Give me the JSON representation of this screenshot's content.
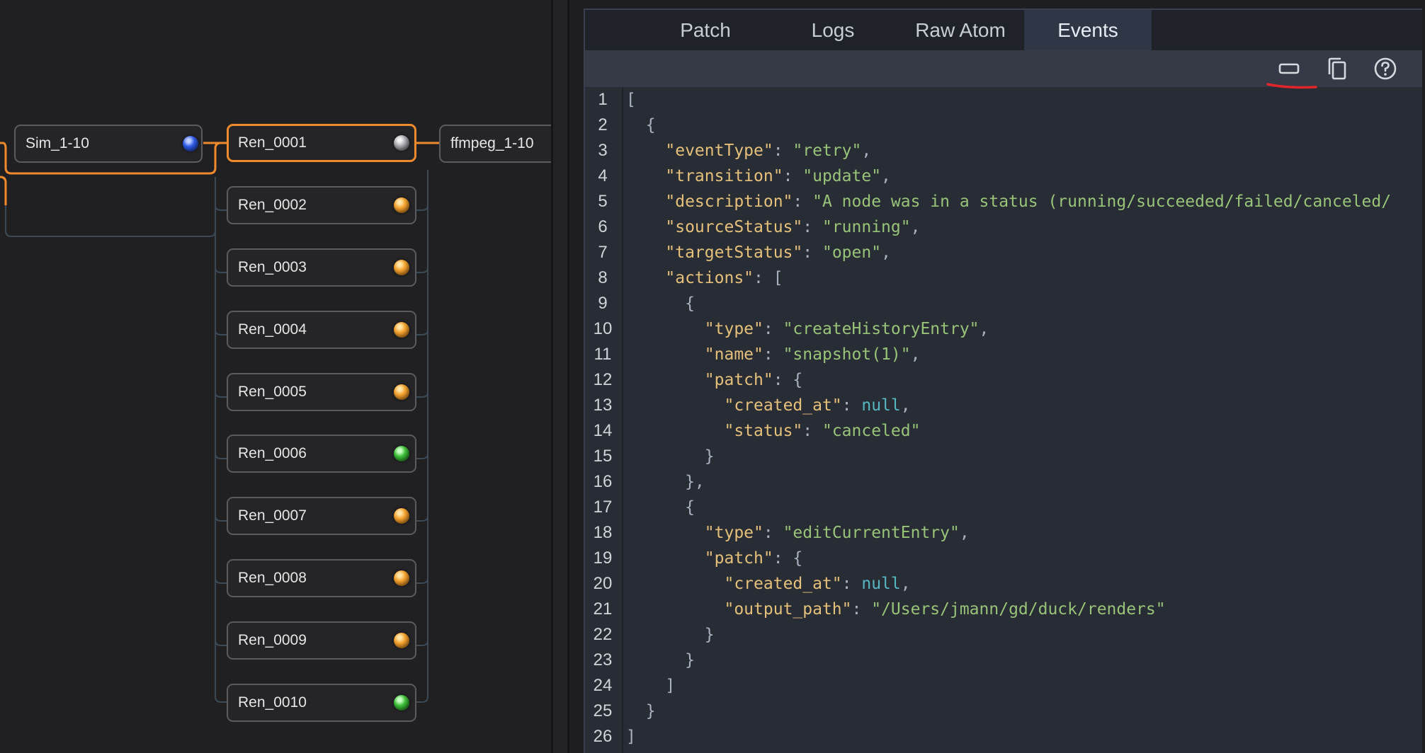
{
  "graph": {
    "nodes": [
      {
        "label": "Sim_1-10",
        "status": "blue"
      },
      {
        "label": "Ren_0001",
        "status": "grey",
        "selected": true
      },
      {
        "label": "ffmpeg_1-10"
      },
      {
        "label": "Ren_0002",
        "status": "orange"
      },
      {
        "label": "Ren_0003",
        "status": "orange"
      },
      {
        "label": "Ren_0004",
        "status": "orange"
      },
      {
        "label": "Ren_0005",
        "status": "orange"
      },
      {
        "label": "Ren_0006",
        "status": "green"
      },
      {
        "label": "Ren_0007",
        "status": "orange"
      },
      {
        "label": "Ren_0008",
        "status": "orange"
      },
      {
        "label": "Ren_0009",
        "status": "orange"
      },
      {
        "label": "Ren_0010",
        "status": "green"
      }
    ]
  },
  "inspector": {
    "tabs": [
      {
        "label": "Patch"
      },
      {
        "label": "Logs"
      },
      {
        "label": "Raw Atom"
      },
      {
        "label": "Events",
        "active": true
      }
    ],
    "toolbar": {
      "icons": [
        "collapse-icon",
        "copy-icon",
        "help-icon"
      ]
    },
    "line_numbers": [
      "1",
      "2",
      "3",
      "4",
      "5",
      "6",
      "7",
      "8",
      "9",
      "10",
      "11",
      "12",
      "13",
      "14",
      "15",
      "16",
      "17",
      "18",
      "19",
      "20",
      "21",
      "22",
      "23",
      "24",
      "25",
      "26"
    ],
    "json_lines": [
      [
        [
          "p",
          "["
        ]
      ],
      [
        [
          "p",
          "  {"
        ]
      ],
      [
        [
          "p",
          "    "
        ],
        [
          "k",
          "\"eventType\""
        ],
        [
          "p",
          ": "
        ],
        [
          "s",
          "\"retry\""
        ],
        [
          "p",
          ","
        ]
      ],
      [
        [
          "p",
          "    "
        ],
        [
          "k",
          "\"transition\""
        ],
        [
          "p",
          ": "
        ],
        [
          "s",
          "\"update\""
        ],
        [
          "p",
          ","
        ]
      ],
      [
        [
          "p",
          "    "
        ],
        [
          "k",
          "\"description\""
        ],
        [
          "p",
          ": "
        ],
        [
          "s",
          "\"A node was in a status (running/succeeded/failed/canceled/"
        ]
      ],
      [
        [
          "p",
          "    "
        ],
        [
          "k",
          "\"sourceStatus\""
        ],
        [
          "p",
          ": "
        ],
        [
          "s",
          "\"running\""
        ],
        [
          "p",
          ","
        ]
      ],
      [
        [
          "p",
          "    "
        ],
        [
          "k",
          "\"targetStatus\""
        ],
        [
          "p",
          ": "
        ],
        [
          "s",
          "\"open\""
        ],
        [
          "p",
          ","
        ]
      ],
      [
        [
          "p",
          "    "
        ],
        [
          "k",
          "\"actions\""
        ],
        [
          "p",
          ": ["
        ]
      ],
      [
        [
          "p",
          "      {"
        ]
      ],
      [
        [
          "p",
          "        "
        ],
        [
          "k",
          "\"type\""
        ],
        [
          "p",
          ": "
        ],
        [
          "s",
          "\"createHistoryEntry\""
        ],
        [
          "p",
          ","
        ]
      ],
      [
        [
          "p",
          "        "
        ],
        [
          "k",
          "\"name\""
        ],
        [
          "p",
          ": "
        ],
        [
          "s",
          "\"snapshot(1)\""
        ],
        [
          "p",
          ","
        ]
      ],
      [
        [
          "p",
          "        "
        ],
        [
          "k",
          "\"patch\""
        ],
        [
          "p",
          ": {"
        ]
      ],
      [
        [
          "p",
          "          "
        ],
        [
          "k",
          "\"created_at\""
        ],
        [
          "p",
          ": "
        ],
        [
          "n",
          "null"
        ],
        [
          "p",
          ","
        ]
      ],
      [
        [
          "p",
          "          "
        ],
        [
          "k",
          "\"status\""
        ],
        [
          "p",
          ": "
        ],
        [
          "s",
          "\"canceled\""
        ]
      ],
      [
        [
          "p",
          "        }"
        ]
      ],
      [
        [
          "p",
          "      },"
        ]
      ],
      [
        [
          "p",
          "      {"
        ]
      ],
      [
        [
          "p",
          "        "
        ],
        [
          "k",
          "\"type\""
        ],
        [
          "p",
          ": "
        ],
        [
          "s",
          "\"editCurrentEntry\""
        ],
        [
          "p",
          ","
        ]
      ],
      [
        [
          "p",
          "        "
        ],
        [
          "k",
          "\"patch\""
        ],
        [
          "p",
          ": {"
        ]
      ],
      [
        [
          "p",
          "          "
        ],
        [
          "k",
          "\"created_at\""
        ],
        [
          "p",
          ": "
        ],
        [
          "n",
          "null"
        ],
        [
          "p",
          ","
        ]
      ],
      [
        [
          "p",
          "          "
        ],
        [
          "k",
          "\"output_path\""
        ],
        [
          "p",
          ": "
        ],
        [
          "s",
          "\"/Users/jmann/gd/duck/renders\""
        ]
      ],
      [
        [
          "p",
          "        }"
        ]
      ],
      [
        [
          "p",
          "      }"
        ]
      ],
      [
        [
          "p",
          "    ]"
        ]
      ],
      [
        [
          "p",
          "  }"
        ]
      ],
      [
        [
          "p",
          "]"
        ]
      ]
    ]
  }
}
